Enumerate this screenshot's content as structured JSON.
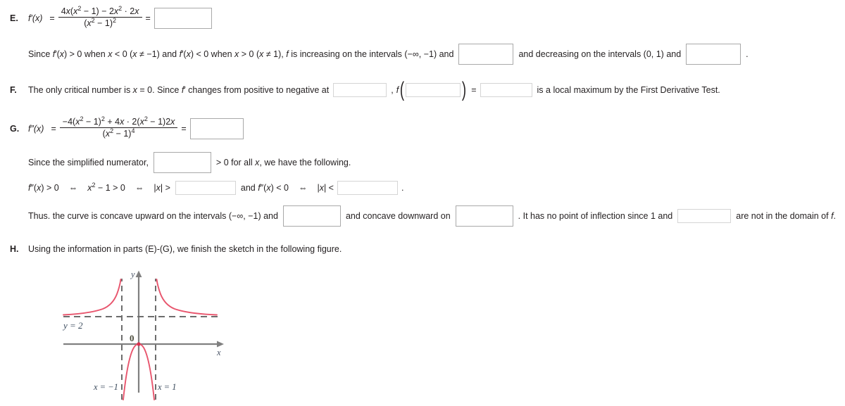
{
  "parts": {
    "E": {
      "label": "E.",
      "fn_name": "f′(x)",
      "equals": "=",
      "fraction": {
        "numerator": "4x(x2 − 1) − 2x2 · 2x",
        "denominator": "(x2 − 1)2"
      },
      "sentence": {
        "part1": "Since f′(x) > 0 when x < 0 (x ≠ −1) and f′(x) < 0 when x > 0 (x ≠ 1), f is increasing on the intervals (−∞, −1) and",
        "part2": "and decreasing on the intervals (0, 1) and",
        "part3": "."
      }
    },
    "F": {
      "label": "F.",
      "sentence": {
        "part1": "The only critical number is x = 0. Since f′ changes from positive to negative at",
        "part2": ",",
        "fn_label": "f",
        "equals": "=",
        "part3": "is a local maximum by the First Derivative Test."
      }
    },
    "G": {
      "label": "G.",
      "fn_name": "f″(x)",
      "equals": "=",
      "fraction": {
        "numerator": "−4(x2 − 1)2 + 4x · 2(x2 − 1)2x",
        "denominator": "(x2 − 1)4"
      },
      "numerator_line": {
        "part1": "Since the simplified numerator,",
        "part2": "> 0 for all x, we have the following."
      },
      "inequality_line": {
        "part1": "f″(x) > 0",
        "iff1": "⇔",
        "part2": "x2 − 1 > 0",
        "iff2": "⇔",
        "part3": "|x| >",
        "part4": "and f″(x) < 0",
        "iff3": "⇔",
        "part5": "|x| <",
        "part6": "."
      },
      "concavity_line": {
        "part1": "Thus. the curve is concave upward on the intervals (−∞, −1) and",
        "part2": "and concave downward on",
        "part3": ". It has no point of inflection since 1 and",
        "part4": "are not in the domain of f."
      }
    },
    "H": {
      "label": "H.",
      "sentence": "Using the information in parts (E)-(G), we finish the sketch in the following figure."
    }
  },
  "chart_data": {
    "type": "line",
    "title": "",
    "xlabel": "x",
    "ylabel": "y",
    "function": "y = 2x²/(x² − 1)",
    "annotations": [
      {
        "name": "horizontal-asymptote-label",
        "text": "y = 2",
        "x": -3.6,
        "y": 1.3
      },
      {
        "name": "vertical-asymptote-left-label",
        "text": "x = −1",
        "x": -2.0,
        "y": -3.4
      },
      {
        "name": "vertical-asymptote-right-label",
        "text": "x = 1",
        "x": 1.3,
        "y": -3.4
      },
      {
        "name": "origin-label",
        "text": "0",
        "x": -0.22,
        "y": 0.45
      }
    ],
    "asymptotes": {
      "horizontal": [
        {
          "y": 2,
          "style": "dashed"
        }
      ],
      "vertical": [
        {
          "x": -1,
          "style": "dashed"
        },
        {
          "x": 1,
          "style": "dashed"
        }
      ]
    },
    "xlim": [
      -4.6,
      4.6
    ],
    "ylim": [
      -4.2,
      4.6
    ],
    "grid": false,
    "curve_color": "#e8556d",
    "axis_color": "#808080",
    "branches": [
      {
        "name": "left-branch",
        "x_range": [
          -4.6,
          -1.08
        ],
        "note": "decreasing from just above y=2 toward +inf as x→−1⁻"
      },
      {
        "name": "middle-branch",
        "x_range": [
          -0.93,
          0.93
        ],
        "note": "downward parabola-like arc with maximum at (0, 0)"
      },
      {
        "name": "right-branch",
        "x_range": [
          1.08,
          4.6
        ],
        "note": "decreasing from +inf at x→1⁺ toward y=2"
      }
    ]
  }
}
